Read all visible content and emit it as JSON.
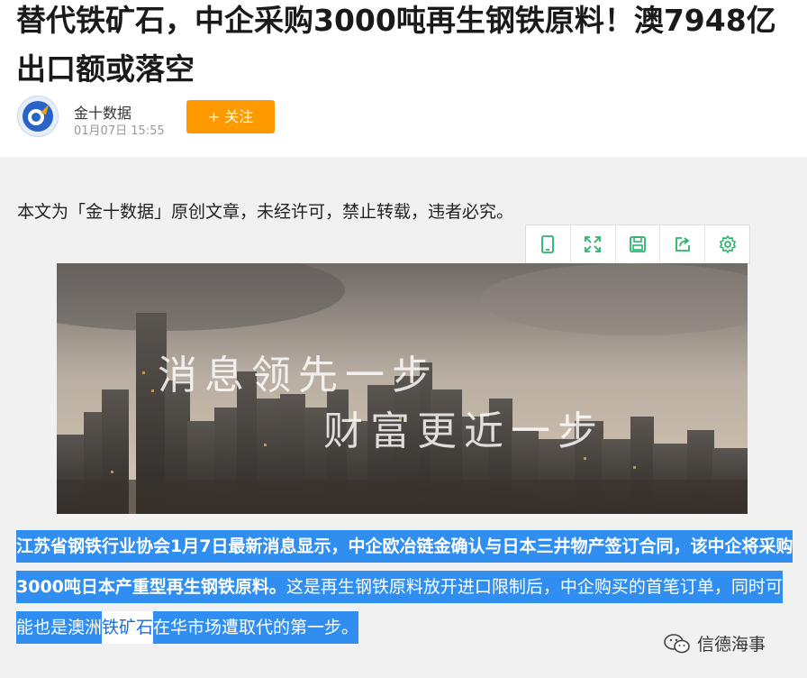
{
  "article": {
    "title": "替代铁矿石，中企采购3000吨再生钢铁原料！澳7948亿出口额或落空",
    "author": "金十数据",
    "date": "01月07日 15:55",
    "follow_label": "+ 关注",
    "notice": "本文为「金十数据」原创文章，未经许可，禁止转载，违者必究。",
    "hero": {
      "line1": "消息领先一步",
      "line2": "财富更近一步"
    },
    "paragraph": {
      "bold": "江苏省钢铁行业协会1月7日最新消息显示，中企欧冶链金确认与日本三井物产签订合同，该中企将采购3000吨日本产重型再生钢铁原料。",
      "normal": "这是再生钢铁原料放开进口限制后，中企购买的首笔订单，同时可能也是澳洲",
      "link": "铁矿石",
      "tail": "在华市场遭取代的第一步。"
    }
  },
  "toolbar": {
    "icons": [
      "tablet-icon",
      "fullscreen-icon",
      "save-icon",
      "share-icon",
      "settings-icon"
    ]
  },
  "watermark": {
    "text": "信德海事"
  },
  "colors": {
    "accent": "#ff9900",
    "highlight": "#2f8ef0",
    "toolbar_icon": "#2bb36b"
  }
}
